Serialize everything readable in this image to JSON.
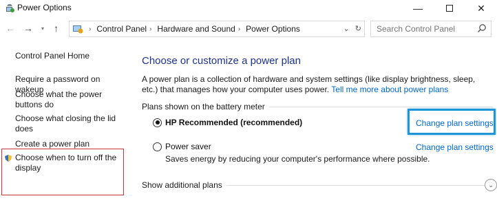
{
  "window": {
    "title": "Power Options",
    "minimize_glyph": "—",
    "close_glyph": "✕"
  },
  "nav": {
    "back_glyph": "←",
    "forward_glyph": "→",
    "recent_glyph": "▾",
    "up_glyph": "↑",
    "breadcrumb": [
      "Control Panel",
      "Hardware and Sound",
      "Power Options"
    ],
    "breadcrumb_sep": "›",
    "dropdown_glyph": "⌄",
    "refresh_glyph": "↻",
    "search_placeholder": "Search Control Panel"
  },
  "sidebar": {
    "home": "Control Panel Home",
    "items": [
      {
        "label": "Require a password on wakeup"
      },
      {
        "label": "Choose what the power buttons do"
      },
      {
        "label": "Choose what closing the lid does"
      },
      {
        "label": "Create a power plan"
      },
      {
        "label": "Choose when to turn off the display"
      }
    ]
  },
  "main": {
    "heading": "Choose or customize a power plan",
    "description": "A power plan is a collection of hardware and system settings (like display brightness, sleep, etc.) that manages how your computer uses power.",
    "learn_more": "Tell me more about power plans",
    "plans_label": "Plans shown on the battery meter",
    "plans": [
      {
        "name": "HP Recommended (recommended)",
        "selected": true,
        "link": "Change plan settings"
      },
      {
        "name": "Power saver",
        "selected": false,
        "link": "Change plan settings",
        "description": "Saves energy by reducing your computer's performance where possible."
      }
    ],
    "additional_plans": "Show additional plans",
    "expand_glyph": "⌄"
  },
  "colors": {
    "heading": "#1e3287",
    "link": "#0066cc",
    "highlight_red": "#c6343b",
    "focus_blue": "#1e96d6"
  }
}
